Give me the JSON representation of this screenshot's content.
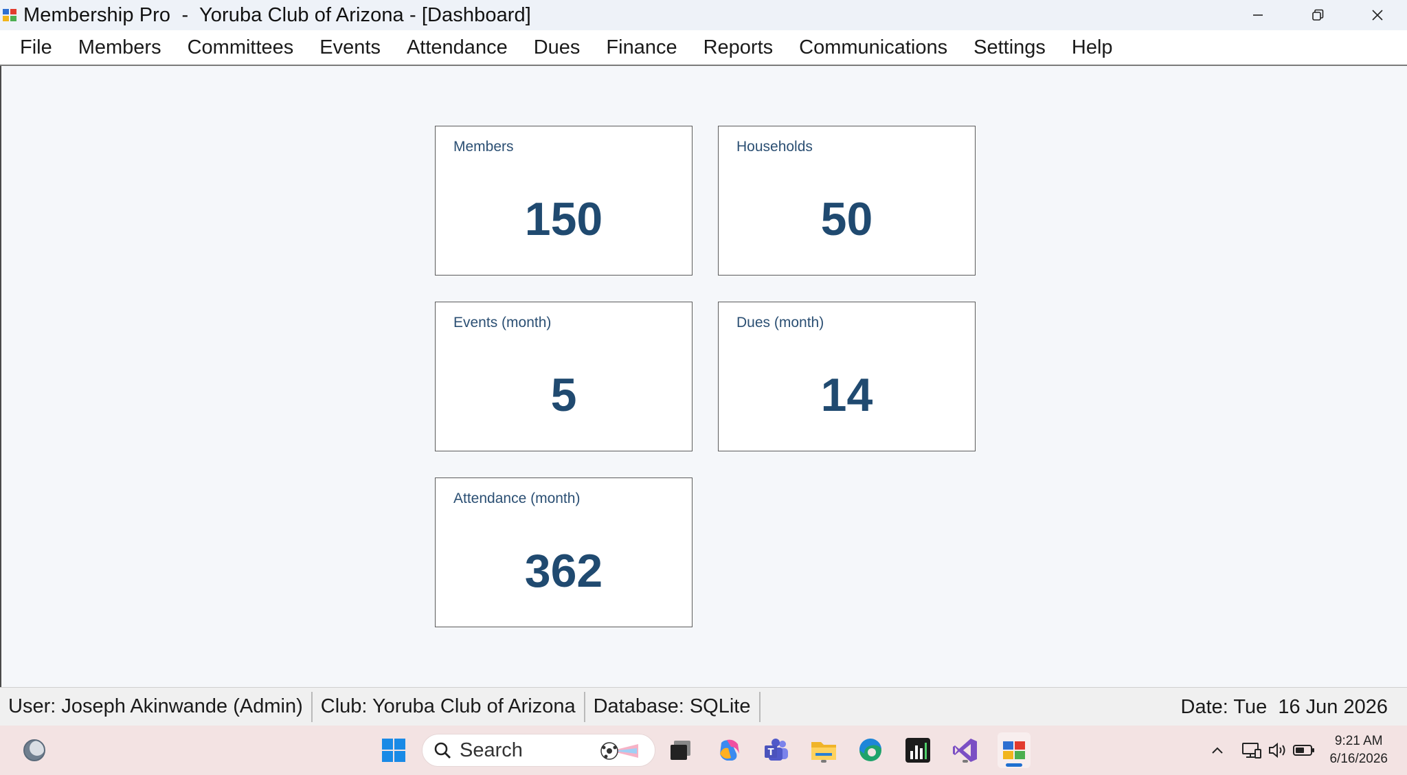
{
  "window": {
    "title": "Membership Pro  -  Yoruba Club of Arizona - [Dashboard]",
    "controls": {
      "minimize": "─",
      "restore": "❐",
      "close": "✕"
    }
  },
  "menu": {
    "items": [
      "File",
      "Members",
      "Committees",
      "Events",
      "Attendance",
      "Dues",
      "Finance",
      "Reports",
      "Communications",
      "Settings",
      "Help"
    ]
  },
  "dashboard": {
    "cards": [
      {
        "label": "Members",
        "value": "150"
      },
      {
        "label": "Households",
        "value": "50"
      },
      {
        "label": "Events (month)",
        "value": "5"
      },
      {
        "label": "Dues (month)",
        "value": "14"
      },
      {
        "label": "Attendance (month)",
        "value": "362"
      }
    ]
  },
  "status": {
    "user": "User: Joseph Akinwande (Admin)",
    "club": "Club: Yoruba Club of Arizona",
    "database": "Database: SQLite",
    "date": "Date: Tue  16 Jun 2026"
  },
  "taskbar": {
    "search_label": "Search",
    "time": "9:21 AM",
    "date": "6/16/2026",
    "icons": [
      "widgets-icon",
      "start-icon",
      "search-icon",
      "task-view-icon",
      "copilot-icon",
      "teams-icon",
      "file-explorer-icon",
      "edge-icon",
      "stock-chart-app-icon",
      "visual-studio-icon",
      "membership-pro-icon"
    ],
    "tray_icons": [
      "chevron-up-icon",
      "network-icon",
      "volume-icon",
      "battery-icon"
    ]
  },
  "colors": {
    "card_value": "#204a70",
    "card_label": "#2b4f73",
    "taskbar_bg": "#f3e3e3",
    "accent": "#1f6fd0"
  }
}
